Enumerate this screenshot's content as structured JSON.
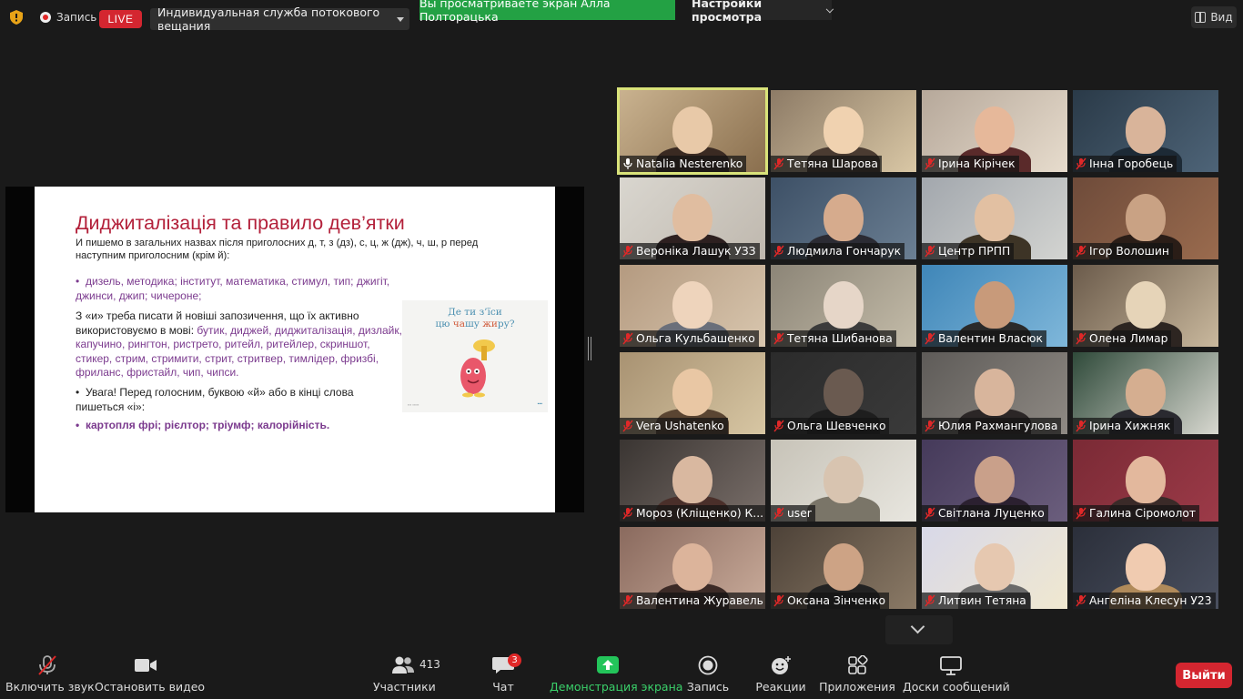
{
  "topbar": {
    "record_label": "Запись",
    "live_label": "LIVE",
    "stream_service": "Индивидуальная служба потокового вещания",
    "viewing_banner": "Вы просматриваете экран Алла Полторацька",
    "view_options": "Настройки просмотра",
    "view_label": "Вид"
  },
  "slide": {
    "title": "Диджиталізація та правило дев’ятки",
    "intro": "И пишемо в загальних назвах після приголосних д, т, з (дз), с, ц, ж (дж), ч, ш, р перед наступним приголосним (крім й):",
    "examples1": "дизель, методика; інститут, математика, стимул, тип; джигіт, джинси, джип; чичероне;",
    "p2_prefix": "З «и» треба писати й новіші запозичення, що їх активно використовуємо в мові:",
    "p2_words": "бутик, диджей, диджиталізація, дизлайк, капучино, рингтон, ристрето, ритейл, ритейлер, скриншот, стикер, стрим, стримити, стрит, стритвер, тимлідер, фризбі, фриланс, фристайл, чип, чипси.",
    "p3": "Увага! Перед голосним, буквою «й» або в кінці слова пишеться «і»:",
    "p4": "картопля фрі; рієлтор; тріумф; калорійність.",
    "card_line1": "Де ти з’їси",
    "card_line2_a": "цю ",
    "card_line2_b": "ча",
    "card_line2_c": "шу ",
    "card_line2_d": "жи",
    "card_line2_e": "ру?"
  },
  "participants": [
    {
      "name": "Natalia Nesterenko",
      "active": true
    },
    {
      "name": "Тетяна Шарова"
    },
    {
      "name": "Ірина Кірічек"
    },
    {
      "name": "Інна Горобець"
    },
    {
      "name": "Вероніка Лашук УЗЗ"
    },
    {
      "name": "Людмила Гончарук"
    },
    {
      "name": "Центр ПРПП"
    },
    {
      "name": "Ігор Волошин"
    },
    {
      "name": "Ольга Кульбашенко"
    },
    {
      "name": "Тетяна Шибанова"
    },
    {
      "name": "Валентин Власюк"
    },
    {
      "name": "Олена Лимар"
    },
    {
      "name": "Vera Ushatenko"
    },
    {
      "name": "Ольга Шевченко"
    },
    {
      "name": "Юлия Рахмангулова"
    },
    {
      "name": "Ірина Хижняк"
    },
    {
      "name": "Мороз (Кліщенко) К..."
    },
    {
      "name": "user"
    },
    {
      "name": "Світлана Луценко"
    },
    {
      "name": "Галина Сіромолот"
    },
    {
      "name": "Валентина Журавель"
    },
    {
      "name": "Оксана Зінченко"
    },
    {
      "name": "Литвин Тетяна"
    },
    {
      "name": "Ангеліна Клесун У23"
    }
  ],
  "toolbar": {
    "unmute": "Включить звук",
    "stop_video": "Остановить видео",
    "participants": "Участники",
    "participants_count": "413",
    "chat": "Чат",
    "chat_badge": "3",
    "share_screen": "Демонстрация экрана",
    "record": "Запись",
    "reactions": "Реакции",
    "apps": "Приложения",
    "whiteboards": "Доски сообщений",
    "leave": "Выйти"
  },
  "colors": {
    "accent_green": "#23a144",
    "live_red": "#d42630",
    "active_speaker": "#d9e37a",
    "slide_title": "#b3203a",
    "slide_purple": "#7b3a8e"
  }
}
